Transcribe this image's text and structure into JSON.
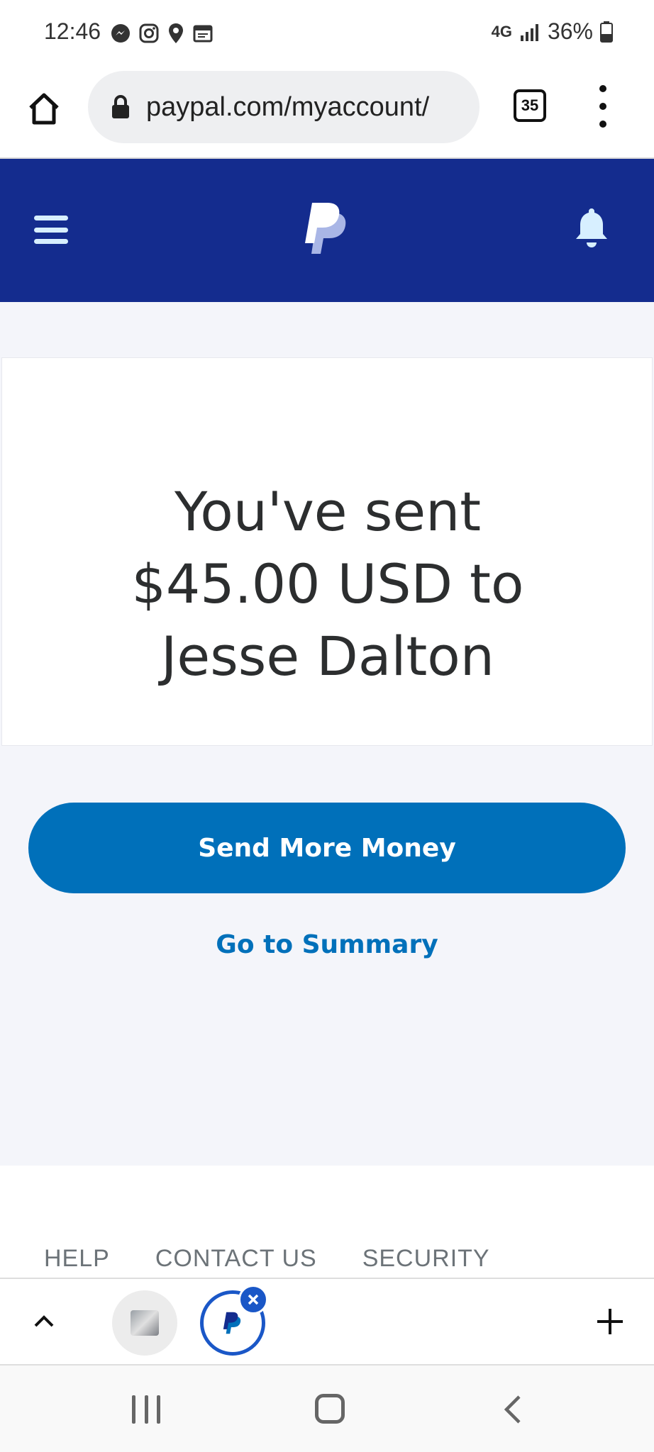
{
  "status_bar": {
    "time": "12:46",
    "network": "4G",
    "battery": "36%"
  },
  "browser": {
    "url": "paypal.com/myaccount/",
    "tab_count": "35"
  },
  "confirmation": {
    "line1": "You've sent",
    "line2": "$45.00 USD to",
    "line3": "Jesse Dalton"
  },
  "actions": {
    "send_more_label": "Send More Money",
    "summary_label": "Go to Summary"
  },
  "footer": {
    "links": [
      "HELP",
      "CONTACT US",
      "SECURITY"
    ]
  },
  "colors": {
    "paypal_navy": "#142c8e",
    "button_blue": "#0070ba",
    "page_bg": "#f4f5fa"
  },
  "icons": {
    "status": [
      "messenger-icon",
      "instagram-icon",
      "location-icon",
      "calendar-icon"
    ],
    "browser": [
      "home-icon",
      "lock-icon",
      "tabs-icon",
      "more-vert-icon"
    ],
    "header": [
      "menu-icon",
      "paypal-logo-icon",
      "bell-icon"
    ]
  }
}
